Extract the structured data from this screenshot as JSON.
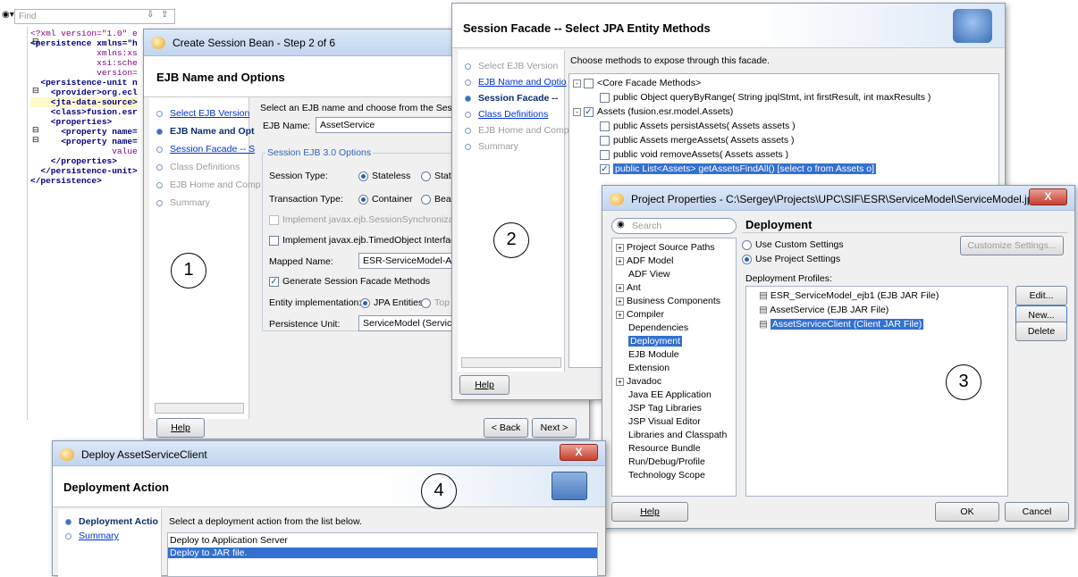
{
  "editor": {
    "find_placeholder": "Find",
    "lines": [
      "<?xml version=\"1.0\" e",
      "<persistence xmlns=\"h",
      "             xmlns:xs",
      "             xsi:sche",
      "             version=",
      "  <persistence-unit n",
      "    <provider>org.ecl",
      "    <jta-data-source>",
      "    <class>fusion.esr",
      "    <properties>",
      "      <property name=",
      "      <property name=",
      "                value",
      "    </properties>",
      "  </persistence-unit>",
      "</persistence>"
    ]
  },
  "session_bean": {
    "title": "Create Session Bean - Step 2 of 6",
    "header": "EJB Name and Options",
    "steps": [
      "Select EJB Version",
      "EJB Name and Opt",
      "Session Facade -- S",
      "Class Definitions",
      "EJB Home and Comp",
      "Summary"
    ],
    "intro": "Select an EJB name and choose from the Sessio",
    "ejb_name_label": "EJB Name:",
    "ejb_name_value": "AssetService",
    "group_label": "Session EJB 3.0 Options",
    "session_type_label": "Session Type:",
    "stateless": "Stateless",
    "stateful": "Stat",
    "transaction_type_label": "Transaction Type:",
    "container": "Container",
    "bean": "Bea",
    "sync_label": "Implement javax.ejb.SessionSynchronizatio",
    "timed_label": "Implement javax.ejb.TimedObject Interface",
    "mapped_name_label": "Mapped Name:",
    "mapped_name_value": "ESR-ServiceModel-Ass",
    "generate_label": "Generate Session Facade Methods",
    "entity_impl_label": "Entity implementation:",
    "jpa_entities": "JPA Entities",
    "top": "Top",
    "persistence_unit_label": "Persistence Unit:",
    "persistence_unit_value": "ServiceModel (ServiceI",
    "help": "Help",
    "back": "< Back",
    "next": "Next >",
    "callout": "1"
  },
  "facade": {
    "title": "Session Facade -- Select JPA Entity Methods",
    "steps": [
      "Select EJB Version",
      "EJB Name and Optio",
      "Session Facade --",
      "Class Definitions",
      "EJB Home and Comp",
      "Summary"
    ],
    "intro": "Choose methods to expose through this facade.",
    "tree": [
      {
        "text": "<Core Facade Methods>",
        "level": 0,
        "checked": false,
        "expander": "-"
      },
      {
        "text": "public Object queryByRange( String jpqlStmt, int firstResult, int maxResults )",
        "level": 1,
        "checked": false
      },
      {
        "text": "Assets (fusion.esr.model.Assets)",
        "level": 0,
        "checked": true,
        "expander": "-"
      },
      {
        "text": "public Assets persistAssets( Assets assets )",
        "level": 1,
        "checked": false
      },
      {
        "text": "public Assets mergeAssets( Assets assets )",
        "level": 1,
        "checked": false
      },
      {
        "text": "public void removeAssets( Assets assets )",
        "level": 1,
        "checked": false
      },
      {
        "text": "public List<Assets> getAssetsFindAll() [select o from Assets o]",
        "level": 1,
        "checked": true,
        "selected": true
      }
    ],
    "help": "Help",
    "callout": "2"
  },
  "project": {
    "title": "Project Properties - C:\\Sergey\\Projects\\UPC\\SIF\\ESR\\ServiceModel\\ServiceModel.jpr",
    "close": "X",
    "search_placeholder": "Search",
    "nav": [
      {
        "label": "Project Source Paths",
        "exp": true
      },
      {
        "label": "ADF Model",
        "exp": true
      },
      {
        "label": "ADF View",
        "exp": false
      },
      {
        "label": "Ant",
        "exp": true
      },
      {
        "label": "Business Components",
        "exp": true
      },
      {
        "label": "Compiler",
        "exp": true
      },
      {
        "label": "Dependencies",
        "exp": false
      },
      {
        "label": "Deployment",
        "exp": false,
        "selected": true
      },
      {
        "label": "EJB Module",
        "exp": false
      },
      {
        "label": "Extension",
        "exp": false
      },
      {
        "label": "Javadoc",
        "exp": true
      },
      {
        "label": "Java EE Application",
        "exp": false
      },
      {
        "label": "JSP Tag Libraries",
        "exp": false
      },
      {
        "label": "JSP Visual Editor",
        "exp": false
      },
      {
        "label": "Libraries and Classpath",
        "exp": false
      },
      {
        "label": "Resource Bundle",
        "exp": false
      },
      {
        "label": "Run/Debug/Profile",
        "exp": false
      },
      {
        "label": "Technology Scope",
        "exp": false
      }
    ],
    "section_title": "Deployment",
    "use_custom": "Use Custom Settings",
    "use_project": "Use Project Settings",
    "customize": "Customize Settings...",
    "profiles_label": "Deployment Profiles:",
    "profiles": [
      {
        "label": "ESR_ServiceModel_ejb1 (EJB JAR File)"
      },
      {
        "label": "AssetService (EJB JAR File)"
      },
      {
        "label": "AssetServiceClient (Client JAR File)",
        "selected": true
      }
    ],
    "edit": "Edit...",
    "new": "New...",
    "delete": "Delete",
    "help": "Help",
    "ok": "OK",
    "cancel": "Cancel",
    "callout": "3"
  },
  "deploy": {
    "title": "Deploy AssetServiceClient",
    "close": "X",
    "header": "Deployment Action",
    "steps": [
      "Deployment Actio",
      "Summary"
    ],
    "intro": "Select a deployment action from the list below.",
    "options": [
      {
        "label": "Deploy to Application Server"
      },
      {
        "label": "Deploy to JAR file.",
        "selected": true
      }
    ],
    "callout": "4"
  }
}
